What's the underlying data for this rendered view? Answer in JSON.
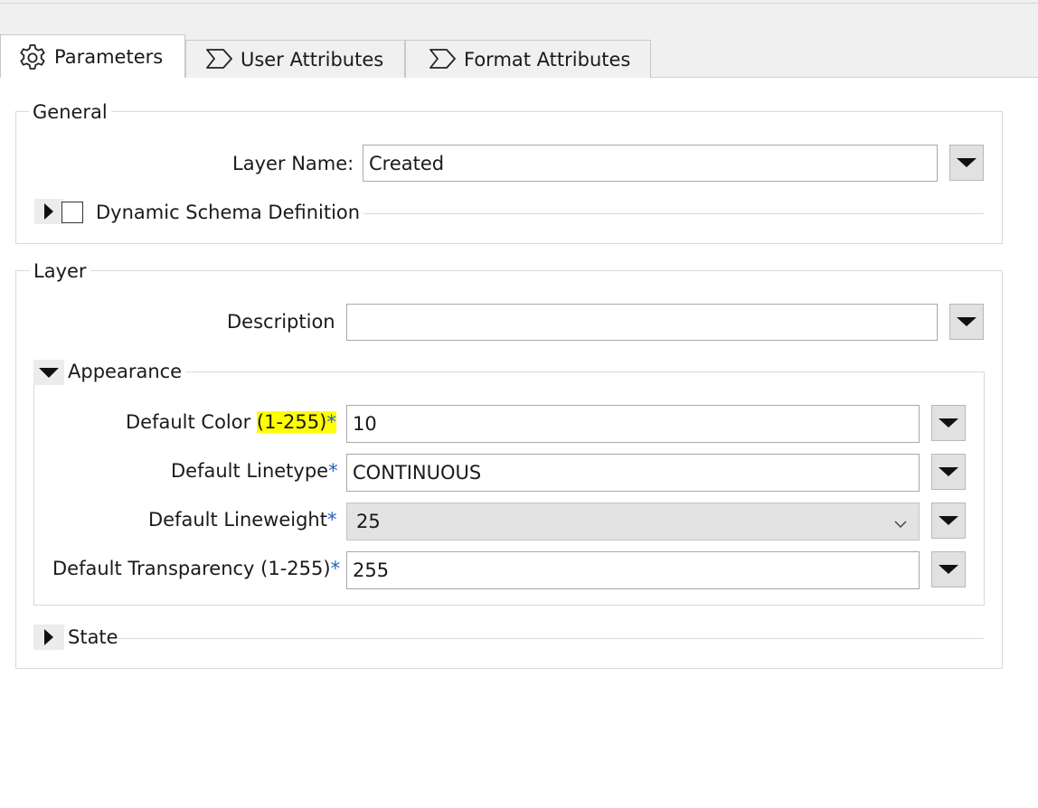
{
  "tabs": [
    {
      "label": "Parameters",
      "icon": "gear-icon",
      "active": true
    },
    {
      "label": "User Attributes",
      "icon": "chevron-tag-icon",
      "active": false
    },
    {
      "label": "Format Attributes",
      "icon": "chevron-tag-icon",
      "active": false
    }
  ],
  "general": {
    "title": "General",
    "layer_name_label": "Layer Name:",
    "layer_name_value": "Created",
    "dynamic_schema_label": "Dynamic Schema Definition",
    "dynamic_schema_checked": false
  },
  "layer": {
    "title": "Layer",
    "description_label": "Description",
    "description_value": "",
    "appearance": {
      "title": "Appearance",
      "expanded": true,
      "default_color_label": "Default Color ",
      "default_color_range": "(1-255)",
      "default_color_value": "10",
      "default_linetype_label": "Default Linetype",
      "default_linetype_value": "CONTINUOUS",
      "default_lineweight_label": "Default Lineweight",
      "default_lineweight_value": "25",
      "default_transparency_label": "Default Transparency (1-255)",
      "default_transparency_value": "255",
      "required_marker": "*"
    },
    "state": {
      "title": "State",
      "expanded": false
    }
  },
  "colors": {
    "highlight": "#ffff00",
    "required_marker": "#1e5fc8",
    "menu_button_bg": "#e1e1e1",
    "select_bg": "#e3e3e3"
  }
}
